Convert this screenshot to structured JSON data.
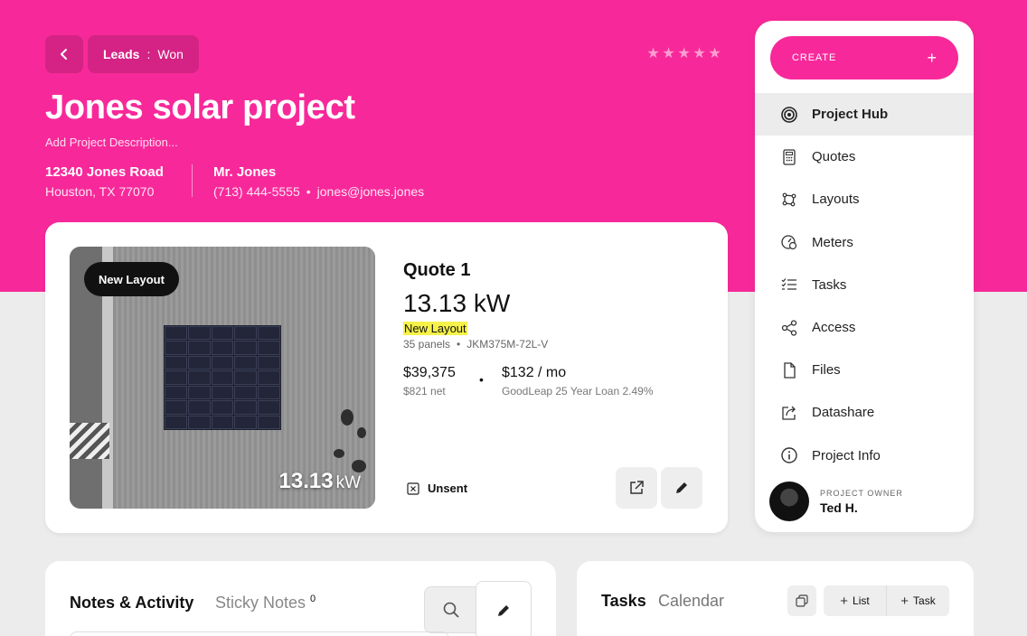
{
  "header": {
    "breadcrumb_primary": "Leads",
    "breadcrumb_sep": ":",
    "breadcrumb_secondary": "Won",
    "title": "Jones solar project",
    "description_placeholder": "Add Project Description...",
    "rating": 0,
    "rating_max": 5,
    "address_line1": "12340 Jones Road",
    "address_line2": "Houston, TX 77070",
    "contact_name": "Mr. Jones",
    "contact_phone": "(713) 444-5555",
    "contact_email": "jones@jones.jones"
  },
  "quote": {
    "image_badge": "New Layout",
    "image_kw_value": "13.13",
    "image_kw_unit": "kW",
    "title": "Quote 1",
    "system_size": "13.13 kW",
    "layout_name": "New Layout",
    "panel_count": "35 panels",
    "panel_model": "JKM375M-72L-V",
    "price": "$39,375",
    "net_price": "$821 net",
    "monthly": "$132 / mo",
    "loan": "GoodLeap 25 Year Loan 2.49%",
    "status": "Unsent"
  },
  "sidebar": {
    "create_label": "CREATE",
    "create_plus": "+",
    "items": [
      {
        "label": "Project Hub",
        "icon": "target-icon",
        "active": true
      },
      {
        "label": "Quotes",
        "icon": "calculator-icon"
      },
      {
        "label": "Layouts",
        "icon": "layout-icon"
      },
      {
        "label": "Meters",
        "icon": "meter-icon"
      },
      {
        "label": "Tasks",
        "icon": "checklist-icon"
      },
      {
        "label": "Access",
        "icon": "share-icon"
      },
      {
        "label": "Files",
        "icon": "file-icon"
      },
      {
        "label": "Datashare",
        "icon": "datashare-icon"
      },
      {
        "label": "Project Info",
        "icon": "info-icon"
      }
    ],
    "owner_label": "PROJECT OWNER",
    "owner_name": "Ted H."
  },
  "notes": {
    "title": "Notes & Activity",
    "tab": "Sticky Notes",
    "sticky_count": "0"
  },
  "tasks": {
    "title": "Tasks",
    "tab": "Calendar",
    "add_list": "List",
    "add_task": "Task"
  },
  "colors": {
    "brand": "#f7299a",
    "highlight": "#f6f24a"
  }
}
